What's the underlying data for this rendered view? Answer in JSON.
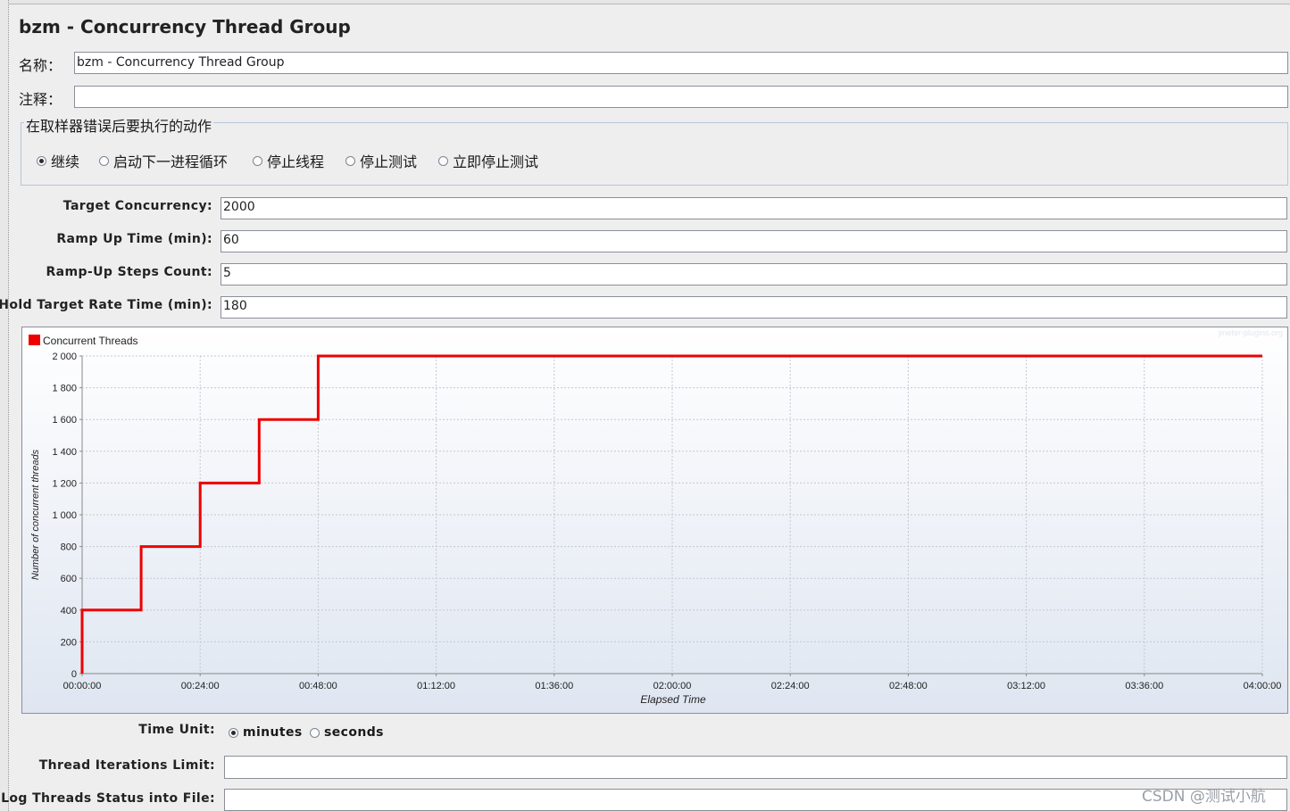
{
  "panel": {
    "title": "bzm - Concurrency Thread Group"
  },
  "name_row": {
    "label": "名称：",
    "value": "bzm - Concurrency Thread Group"
  },
  "comment_row": {
    "label": "注释：",
    "value": ""
  },
  "sampler_error": {
    "title": "在取样器错误后要执行的动作",
    "options": [
      {
        "label": "继续",
        "selected": true
      },
      {
        "label": "启动下一进程循环",
        "selected": false
      },
      {
        "label": "停止线程",
        "selected": false
      },
      {
        "label": "停止测试",
        "selected": false
      },
      {
        "label": "立即停止测试",
        "selected": false
      }
    ]
  },
  "params": {
    "target_concurrency": {
      "label": "Target Concurrency:",
      "value": "2000"
    },
    "ramp_up_time": {
      "label": "Ramp Up Time (min):",
      "value": "60"
    },
    "ramp_up_steps": {
      "label": "Ramp-Up Steps Count:",
      "value": "5"
    },
    "hold_time": {
      "label": "Hold Target Rate Time (min):",
      "value": "180"
    }
  },
  "chart_data": {
    "type": "line",
    "step": true,
    "legend": "Concurrent Threads",
    "legend_position": "top-left",
    "credit": "jmeter-plugins.org",
    "xlabel": "Elapsed Time",
    "ylabel": "Number of concurrent threads",
    "xlim": [
      0,
      240
    ],
    "ylim": [
      0,
      2000
    ],
    "grid": true,
    "series_color": "#ee0000",
    "x_ticks": [
      {
        "v": 0,
        "label": "00:00:00"
      },
      {
        "v": 24,
        "label": "00:24:00"
      },
      {
        "v": 48,
        "label": "00:48:00"
      },
      {
        "v": 72,
        "label": "01:12:00"
      },
      {
        "v": 96,
        "label": "01:36:00"
      },
      {
        "v": 120,
        "label": "02:00:00"
      },
      {
        "v": 144,
        "label": "02:24:00"
      },
      {
        "v": 168,
        "label": "02:48:00"
      },
      {
        "v": 192,
        "label": "03:12:00"
      },
      {
        "v": 216,
        "label": "03:36:00"
      },
      {
        "v": 240,
        "label": "04:00:00"
      }
    ],
    "y_ticks": [
      {
        "v": 0,
        "label": "0"
      },
      {
        "v": 200,
        "label": "200"
      },
      {
        "v": 400,
        "label": "400"
      },
      {
        "v": 600,
        "label": "600"
      },
      {
        "v": 800,
        "label": "800"
      },
      {
        "v": 1000,
        "label": "1 000"
      },
      {
        "v": 1200,
        "label": "1 200"
      },
      {
        "v": 1400,
        "label": "1 400"
      },
      {
        "v": 1600,
        "label": "1 600"
      },
      {
        "v": 1800,
        "label": "1 800"
      },
      {
        "v": 2000,
        "label": "2 000"
      }
    ],
    "points": [
      [
        0,
        0
      ],
      [
        0,
        400
      ],
      [
        12,
        400
      ],
      [
        12,
        800
      ],
      [
        24,
        800
      ],
      [
        24,
        1200
      ],
      [
        36,
        1200
      ],
      [
        36,
        1600
      ],
      [
        48,
        1600
      ],
      [
        48,
        2000
      ],
      [
        240,
        2000
      ]
    ]
  },
  "time_unit": {
    "label": "Time Unit:",
    "options": [
      {
        "label": "minutes",
        "selected": true
      },
      {
        "label": "seconds",
        "selected": false
      }
    ]
  },
  "iterations_limit": {
    "label": "Thread Iterations Limit:",
    "value": ""
  },
  "log_file": {
    "label": "Log Threads Status into File:",
    "value": ""
  },
  "watermark": "CSDN @测试小航"
}
